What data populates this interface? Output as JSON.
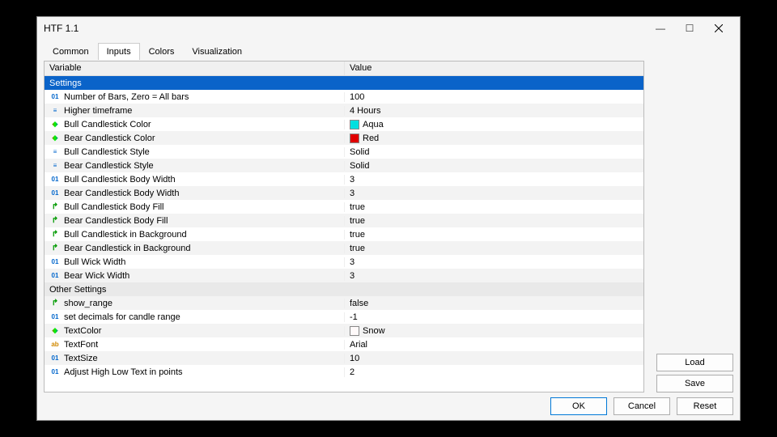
{
  "window": {
    "title": "HTF 1.1"
  },
  "tabs": [
    {
      "label": "Common",
      "active": false
    },
    {
      "label": "Inputs",
      "active": true
    },
    {
      "label": "Colors",
      "active": false
    },
    {
      "label": "Visualization",
      "active": false
    }
  ],
  "grid": {
    "headers": {
      "variable": "Variable",
      "value": "Value"
    },
    "section1": "Settings",
    "section2": "Other Settings",
    "rows1": [
      {
        "type": "int",
        "label": "Number of Bars, Zero = All bars",
        "value": "100"
      },
      {
        "type": "enum",
        "label": "Higher timeframe",
        "value": "4 Hours"
      },
      {
        "type": "color",
        "label": "Bull Candlestick Color",
        "value": "Aqua",
        "swatch": "#00e0e0"
      },
      {
        "type": "color",
        "label": "Bear Candlestick Color",
        "value": "Red",
        "swatch": "#e00000"
      },
      {
        "type": "enum",
        "label": "Bull Candlestick Style",
        "value": "Solid"
      },
      {
        "type": "enum",
        "label": "Bear Candlestick Style",
        "value": "Solid"
      },
      {
        "type": "int",
        "label": "Bull Candlestick Body Width",
        "value": "3"
      },
      {
        "type": "int",
        "label": "Bear Candlestick Body Width",
        "value": "3"
      },
      {
        "type": "bool",
        "label": "Bull Candlestick Body Fill",
        "value": "true"
      },
      {
        "type": "bool",
        "label": "Bear Candlestick Body Fill",
        "value": "true"
      },
      {
        "type": "bool",
        "label": "Bull Candlestick in Background",
        "value": "true"
      },
      {
        "type": "bool",
        "label": "Bear Candlestick in Background",
        "value": "true"
      },
      {
        "type": "int",
        "label": "Bull Wick Width",
        "value": "3"
      },
      {
        "type": "int",
        "label": "Bear Wick Width",
        "value": "3"
      }
    ],
    "rows2": [
      {
        "type": "bool",
        "label": "show_range",
        "value": "false"
      },
      {
        "type": "int",
        "label": "set decimals for candle range",
        "value": "-1"
      },
      {
        "type": "color",
        "label": "TextColor",
        "value": "Snow",
        "swatch": "#fffafa"
      },
      {
        "type": "str",
        "label": "TextFont",
        "value": "Arial"
      },
      {
        "type": "int",
        "label": "TextSize",
        "value": "10"
      },
      {
        "type": "int",
        "label": "Adjust High Low Text in points",
        "value": "2"
      }
    ]
  },
  "side": {
    "load": "Load",
    "save": "Save"
  },
  "bottom": {
    "ok": "OK",
    "cancel": "Cancel",
    "reset": "Reset"
  }
}
